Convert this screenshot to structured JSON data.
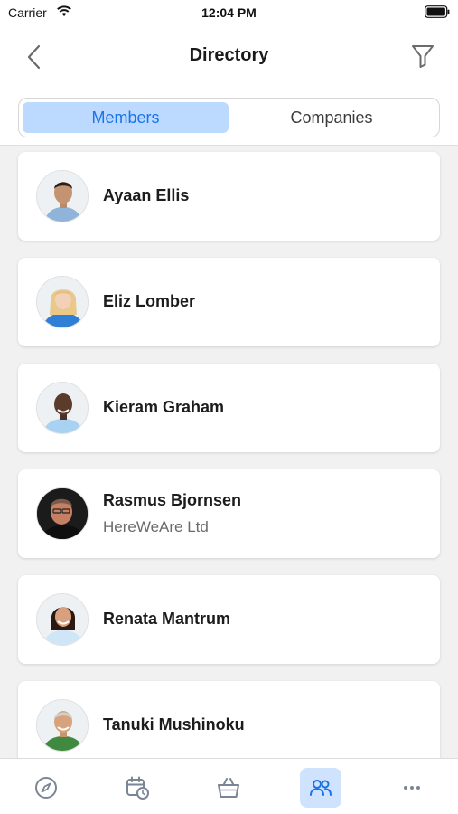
{
  "status_bar": {
    "carrier": "Carrier",
    "time": "12:04 PM"
  },
  "header": {
    "title": "Directory",
    "back_icon": "chevron-left-icon",
    "filter_icon": "filter-icon"
  },
  "segments": {
    "active": "Members",
    "inactive": "Companies"
  },
  "members": [
    {
      "name": "Ayaan Ellis",
      "company": ""
    },
    {
      "name": "Eliz Lomber",
      "company": ""
    },
    {
      "name": "Kieram Graham",
      "company": ""
    },
    {
      "name": "Rasmus Bjornsen",
      "company": "HereWeAre Ltd"
    },
    {
      "name": "Renata Mantrum",
      "company": ""
    },
    {
      "name": "Tanuki Mushinoku",
      "company": ""
    }
  ],
  "tabs": [
    {
      "icon": "compass-icon",
      "active": false
    },
    {
      "icon": "calendar-clock-icon",
      "active": false
    },
    {
      "icon": "basket-icon",
      "active": false
    },
    {
      "icon": "people-icon",
      "active": true
    },
    {
      "icon": "more-icon",
      "active": false
    }
  ],
  "colors": {
    "accent": "#1a73e8",
    "segment_active_bg": "#bcd9ff",
    "tab_active_bg": "#cfe3ff",
    "background": "#f1f1f1"
  }
}
